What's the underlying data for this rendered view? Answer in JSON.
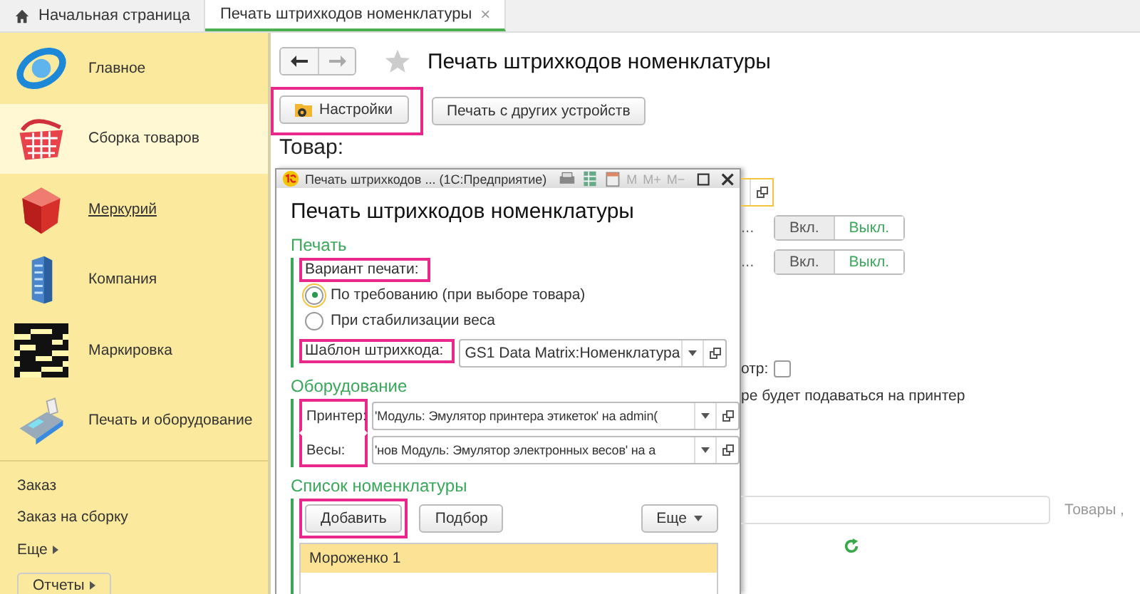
{
  "tabs": [
    {
      "label": "Начальная страница",
      "selected": false
    },
    {
      "label": "Печать штрихкодов номенклатуры",
      "selected": true,
      "close": "×"
    }
  ],
  "sidebar": {
    "sections": [
      {
        "label": "Главное",
        "selected": false,
        "link": false
      },
      {
        "label": "Сборка товаров",
        "selected": true,
        "link": false
      },
      {
        "label": "Меркурий",
        "selected": false,
        "link": true
      },
      {
        "label": "Компания",
        "selected": false,
        "link": false
      },
      {
        "label": "Маркировка",
        "selected": false,
        "link": false
      },
      {
        "label": "Печать и оборудование",
        "selected": false,
        "link": false
      }
    ],
    "links": [
      "Заказ",
      "Заказ на сборку"
    ],
    "more": "Еще",
    "reports": "Отчеты"
  },
  "page": {
    "title": "Печать штрихкодов номенклатуры",
    "buttons": [
      {
        "label": "Настройки",
        "highlighted": true
      },
      {
        "label": "Печать с других устройств",
        "highlighted": false
      }
    ],
    "section_label": "Товар:",
    "toggles": [
      {
        "cut_label": "...",
        "on": "Вкл.",
        "off": "Выкл.",
        "on_selected": false
      },
      {
        "cut_label": "...",
        "on": "Вкл.",
        "off": "Выкл.",
        "on_selected": false
      }
    ],
    "checkbox": {
      "label": "отр:",
      "checked": false
    },
    "note": "ре будет подаваться на принтер",
    "search_hint": "Товары ,"
  },
  "dialog": {
    "title": "Печать штрихкодов ... (1С:Предприятие)",
    "memory_buttons": [
      "M",
      "M+",
      "M−"
    ],
    "heading": "Печать штрихкодов номенклатуры",
    "print": {
      "title": "Печать",
      "variant_label": "Вариант печати:",
      "variant_highlighted": true,
      "options": [
        {
          "label": "По требованию (при выборе товара)",
          "selected": true
        },
        {
          "label": "При стабилизации веса",
          "selected": false
        }
      ],
      "template": {
        "label": "Шаблон штрихкода:",
        "value": "GS1 Data Matrix:Номенклатура",
        "highlighted": true
      }
    },
    "equipment": {
      "title": "Оборудование",
      "labels_highlighted": true,
      "fields": [
        {
          "label": "Принтер:",
          "value": "'Модуль: Эмулятор принтера этикеток' на admin("
        },
        {
          "label": "Весы:",
          "value": "'нов Модуль: Эмулятор электронных весов' на а"
        }
      ]
    },
    "list": {
      "title": "Список номенклатуры",
      "buttons": [
        {
          "label": "Добавить",
          "highlighted": true
        },
        {
          "label": "Подбор",
          "highlighted": false
        }
      ],
      "more": "Еще",
      "rows": [
        {
          "name": "Мороженко 1",
          "selected": true
        }
      ]
    }
  }
}
